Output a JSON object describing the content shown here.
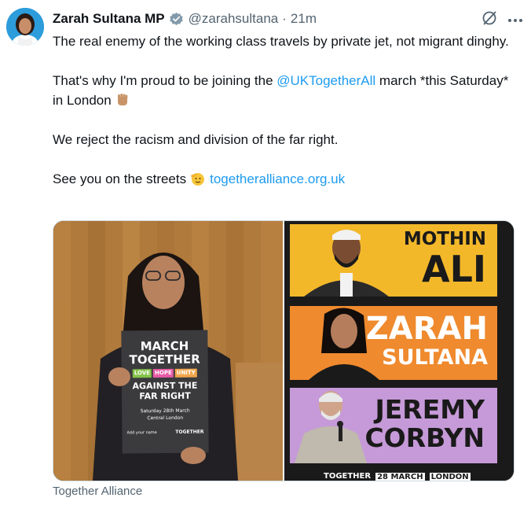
{
  "author": {
    "name": "Zarah Sultana MP",
    "handle": "@zarahsultana",
    "separator": "·",
    "time": "21m"
  },
  "icons": {
    "verified": "verified-badge-icon",
    "grok": "grok-icon",
    "more": "more-icon",
    "fist_emoji": "raised-fist-emoji",
    "salute_emoji": "saluting-face-emoji"
  },
  "tweet": {
    "line1": "The real enemy of the working class travels by private jet, not migrant dinghy.",
    "line2_before": "That's why I'm proud to be joining the ",
    "line2_mention": "@UKTogetherAll",
    "line2_after": " march *this Saturday* in London",
    "line3": "We reject the racism and division of the far right.",
    "line4_before": "See you on the streets",
    "line4_link": "togetheralliance.org.uk"
  },
  "media": {
    "sign": {
      "line1": "MARCH",
      "line2": "TOGETHER",
      "tag_love": "LOVE",
      "tag_hope": "HOPE",
      "tag_unity": "UNITY",
      "line3": "AGAINST THE",
      "line4": "FAR RIGHT",
      "date": "Saturday 28th March",
      "place": "Central London",
      "footer_small": "Add your name",
      "footer_brand": "TOGETHER"
    },
    "panels": [
      {
        "first": "MOTHIN",
        "last": "ALI"
      },
      {
        "first": "ZARAH",
        "last": "SULTANA"
      },
      {
        "first": "JEREMY",
        "last": "CORBYN"
      }
    ],
    "bottom_strip": {
      "brand": "TOGETHER",
      "date": "28 MARCH",
      "city": "LONDON"
    }
  },
  "card_source": "Together Alliance",
  "colors": {
    "link": "#1d9bf0",
    "verified": "#829aab",
    "panel_yellow": "#f3b82a",
    "panel_orange": "#ef8a2e",
    "panel_purple": "#c69ad8",
    "sign_bg": "#3b3b3e"
  }
}
